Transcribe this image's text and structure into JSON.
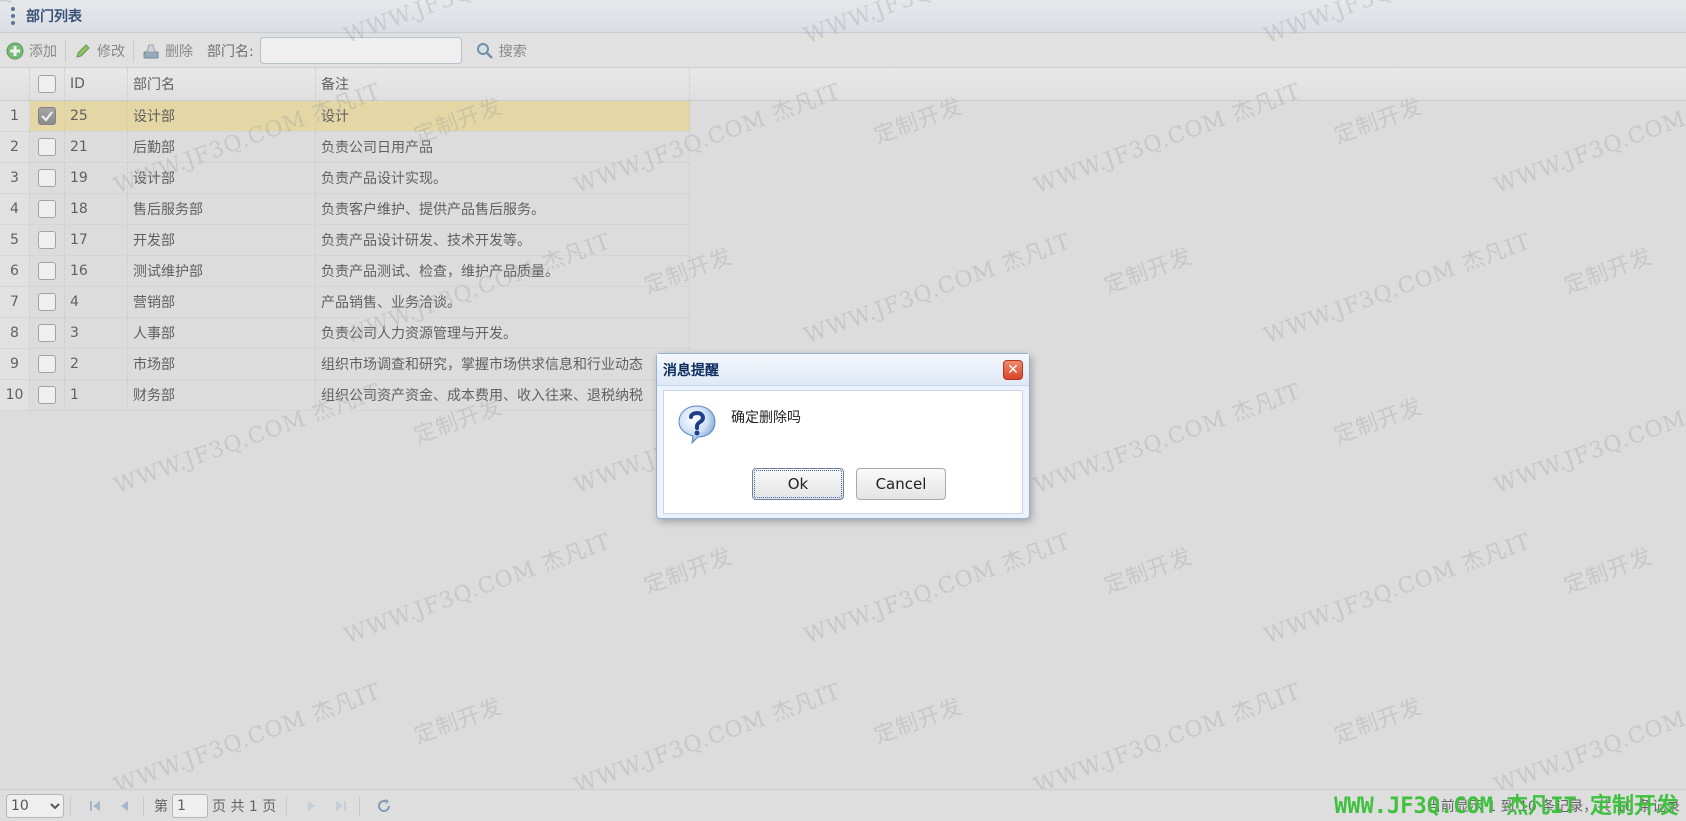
{
  "panel": {
    "title": "部门列表"
  },
  "toolbar": {
    "add_label": "添加",
    "edit_label": "修改",
    "delete_label": "删除",
    "search_field_label": "部门名:",
    "search_value": "",
    "search_label": "搜索"
  },
  "grid": {
    "columns": {
      "id": "ID",
      "name": "部门名",
      "remark": "备注"
    },
    "rows": [
      {
        "num": "1",
        "checked": true,
        "id": "25",
        "name": "设计部",
        "remark": "设计"
      },
      {
        "num": "2",
        "checked": false,
        "id": "21",
        "name": "后勤部",
        "remark": "负责公司日用产品"
      },
      {
        "num": "3",
        "checked": false,
        "id": "19",
        "name": "设计部",
        "remark": "负责产品设计实现。"
      },
      {
        "num": "4",
        "checked": false,
        "id": "18",
        "name": "售后服务部",
        "remark": "负责客户维护、提供产品售后服务。"
      },
      {
        "num": "5",
        "checked": false,
        "id": "17",
        "name": "开发部",
        "remark": "负责产品设计研发、技术开发等。"
      },
      {
        "num": "6",
        "checked": false,
        "id": "16",
        "name": "测试维护部",
        "remark": "负责产品测试、检查，维护产品质量。"
      },
      {
        "num": "7",
        "checked": false,
        "id": "4",
        "name": "营销部",
        "remark": "产品销售、业务洽谈。"
      },
      {
        "num": "8",
        "checked": false,
        "id": "3",
        "name": "人事部",
        "remark": "负责公司人力资源管理与开发。"
      },
      {
        "num": "9",
        "checked": false,
        "id": "2",
        "name": "市场部",
        "remark": "组织市场调查和研究，掌握市场供求信息和行业动态"
      },
      {
        "num": "10",
        "checked": false,
        "id": "1",
        "name": "财务部",
        "remark": "组织公司资产资金、成本费用、收入往来、退税纳税"
      }
    ]
  },
  "pager": {
    "page_size": "10",
    "page_prefix": "第",
    "page_number": "1",
    "page_suffix": "页 共 1 页",
    "info": "当前显示 1 到 10 条记录，共 10 条记录"
  },
  "dialog": {
    "title": "消息提醒",
    "close_symbol": "✕",
    "message": "确定删除吗",
    "ok_label": "Ok",
    "cancel_label": "Cancel"
  },
  "watermark": {
    "site": "WWW.JF3Q.COM 杰凡IT",
    "custom": "定制开发",
    "brand": "WWW.JF3Q.COM 杰凡IT  定制开发"
  },
  "colors": {
    "selected_row": "#f0de9c",
    "brand_watermark": "#14c214",
    "title_text": "#0e2d5f",
    "dialog_border": "#8eb2dd"
  }
}
